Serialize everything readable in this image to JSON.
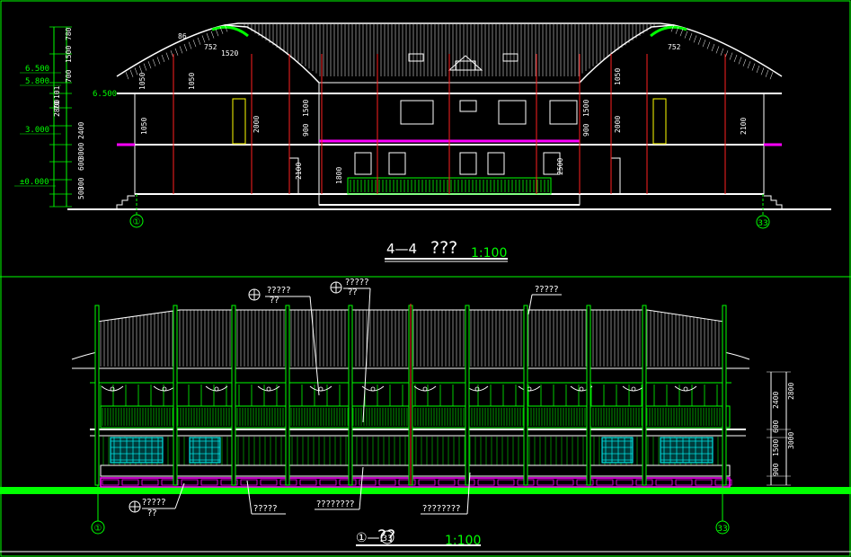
{
  "section": {
    "title_prefix": "4—4",
    "title_glyphs": "???",
    "scale": "1:100",
    "axis_left": "①",
    "axis_right": "33",
    "levels": [
      "6.500",
      "5.800",
      "3.000",
      "±0.000",
      "6.500"
    ],
    "dims_vertical": [
      "780",
      "1500",
      "700",
      "101",
      "70",
      "2800",
      "2400",
      "3000",
      "600",
      "300",
      "500"
    ],
    "dims_interior": [
      "1050",
      "1050",
      "2000",
      "1500",
      "1050",
      "2000",
      "1500",
      "900",
      "2100",
      "1800",
      "2500",
      "1050",
      "900",
      "2100"
    ],
    "roof_labels": [
      "752",
      "1520",
      "752",
      "86"
    ]
  },
  "elevation": {
    "title_prefix": "①—",
    "title_circle": "33",
    "title_glyphs": "??",
    "scale": "1:100",
    "axis_left": "①",
    "axis_right": "33",
    "callouts": [
      "?????",
      "??",
      "?????",
      "??",
      "?????",
      "?????",
      "??",
      "?????",
      "????????",
      "????????"
    ],
    "dims_right": [
      "2400",
      "2800",
      "600",
      "1500",
      "3000",
      "900"
    ]
  },
  "colors": {
    "line_white": "#ffffff",
    "cad_green": "#00ff00",
    "cad_red": "#ff2020",
    "cad_magenta": "#ff00ff",
    "cad_cyan": "#00e0e0",
    "cad_yellow": "#ffff00"
  }
}
